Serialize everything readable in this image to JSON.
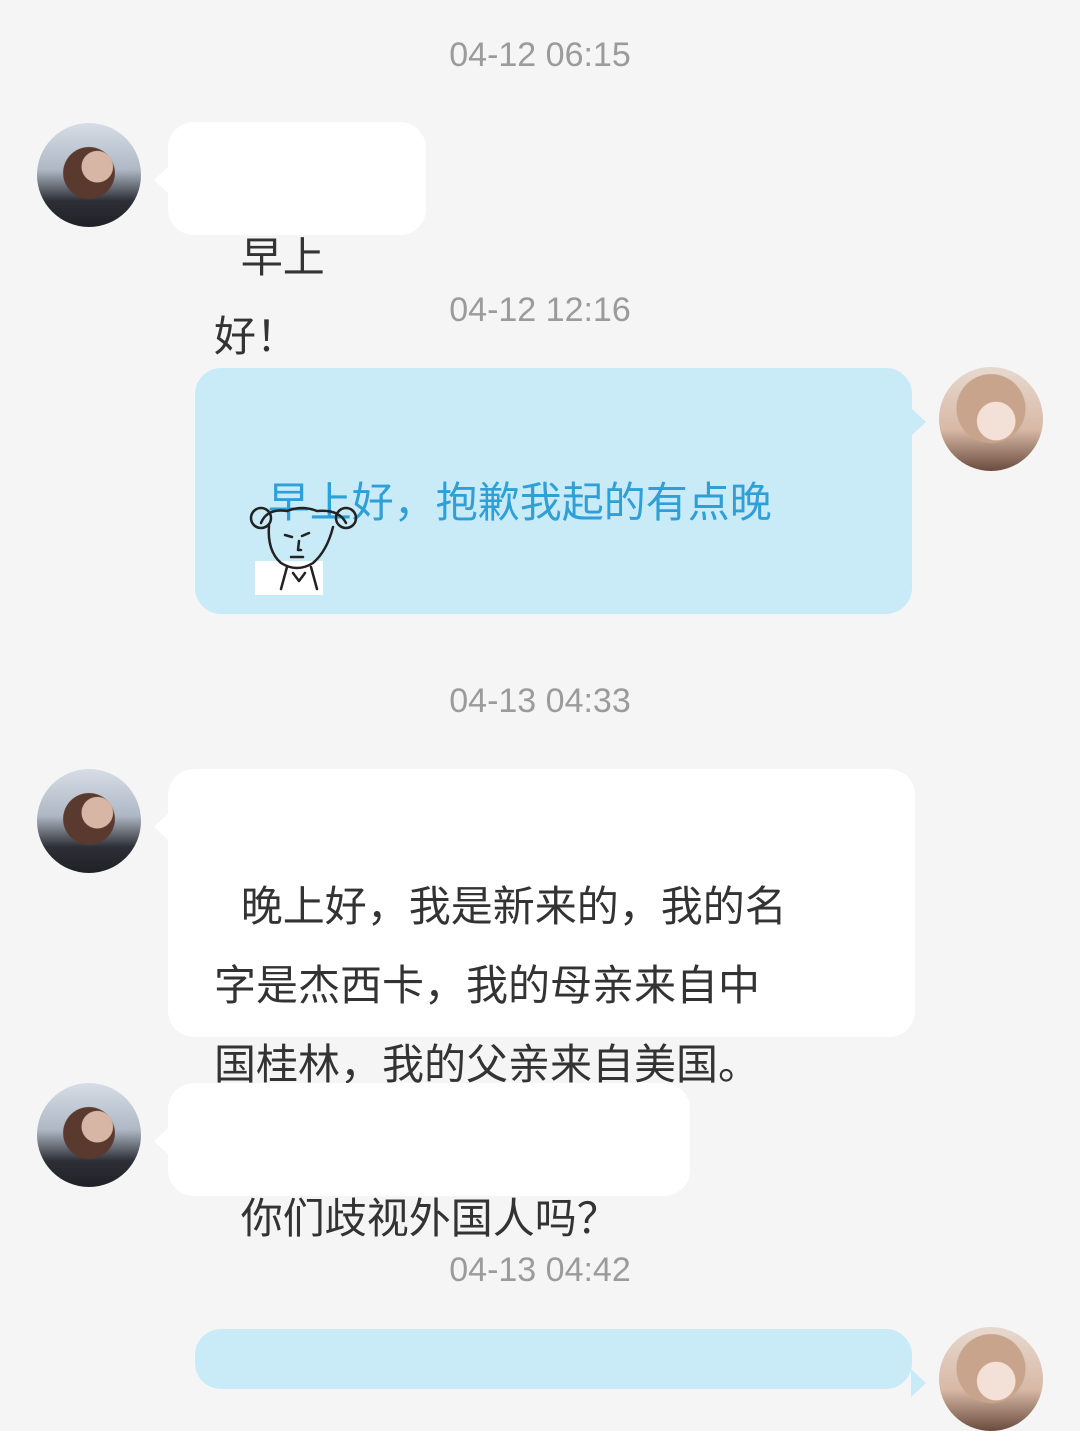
{
  "timestamps": [
    "04-12 06:15",
    "04-12 12:16",
    "04-13 04:33",
    "04-13 04:42"
  ],
  "messages": [
    {
      "side": "left",
      "text": "早上好！"
    },
    {
      "side": "right",
      "text": "早上好，抱歉我起的有点晚"
    },
    {
      "side": "left",
      "text": "晚上好，我是新来的，我的名\n字是杰西卡，我的母亲来自中\n国桂林，我的父亲来自美国。"
    },
    {
      "side": "left",
      "text": "你们歧视外国人吗？"
    }
  ],
  "colors": {
    "background": "#f5f5f5",
    "incoming_bubble": "#ffffff",
    "outgoing_bubble": "#c9ebf7",
    "outgoing_text": "#2f9fd8",
    "timestamp_text": "#9b9b9b"
  },
  "icons": {
    "left_avatar": "avatar",
    "right_avatar": "avatar",
    "sticker": "sketch-face-sticker"
  }
}
